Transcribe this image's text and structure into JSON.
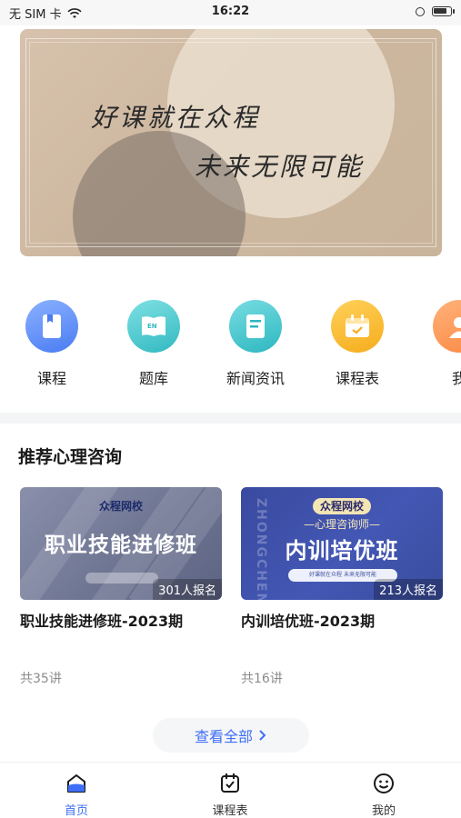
{
  "status_bar": {
    "carrier": "无 SIM 卡",
    "time": "16:22",
    "battery_level": 0.85
  },
  "banner": {
    "line1": "好课就在众程",
    "line2": "未来无限可能"
  },
  "quick_nav": [
    {
      "label": "课程",
      "icon": "book-icon",
      "color": "#4a7cf2"
    },
    {
      "label": "题库",
      "icon": "open-book-icon",
      "color": "#32b9c1"
    },
    {
      "label": "新闻资讯",
      "icon": "document-icon",
      "color": "#2eb7c0"
    },
    {
      "label": "课程表",
      "icon": "calendar-icon",
      "color": "#f5ad1c"
    },
    {
      "label": "我",
      "icon": "user-icon",
      "color": "#fb8a45"
    }
  ],
  "section": {
    "title": "推荐心理咨询"
  },
  "courses": [
    {
      "logo": "众程网校",
      "image_title": "职业技能进修班",
      "enrolled": "301人报名",
      "title": "职业技能进修班-2023期",
      "lessons": "共35讲"
    },
    {
      "logo": "众程网校",
      "image_subtitle": "—心理咨询师—",
      "image_title": "内训培优班",
      "image_side_text": "ZHONGCHENG",
      "image_bar_text": "好课就在众程   未来无限可能",
      "enrolled": "213人报名",
      "title": "内训培优班-2023期",
      "lessons": "共16讲"
    }
  ],
  "view_all": {
    "label": "查看全部"
  },
  "tab_bar": [
    {
      "label": "首页",
      "icon": "home-icon",
      "active": true
    },
    {
      "label": "课程表",
      "icon": "calendar-check-icon",
      "active": false
    },
    {
      "label": "我的",
      "icon": "smiley-icon",
      "active": false
    }
  ],
  "colors": {
    "accent": "#3d6ef5",
    "muted_text": "#8c8c8c"
  }
}
